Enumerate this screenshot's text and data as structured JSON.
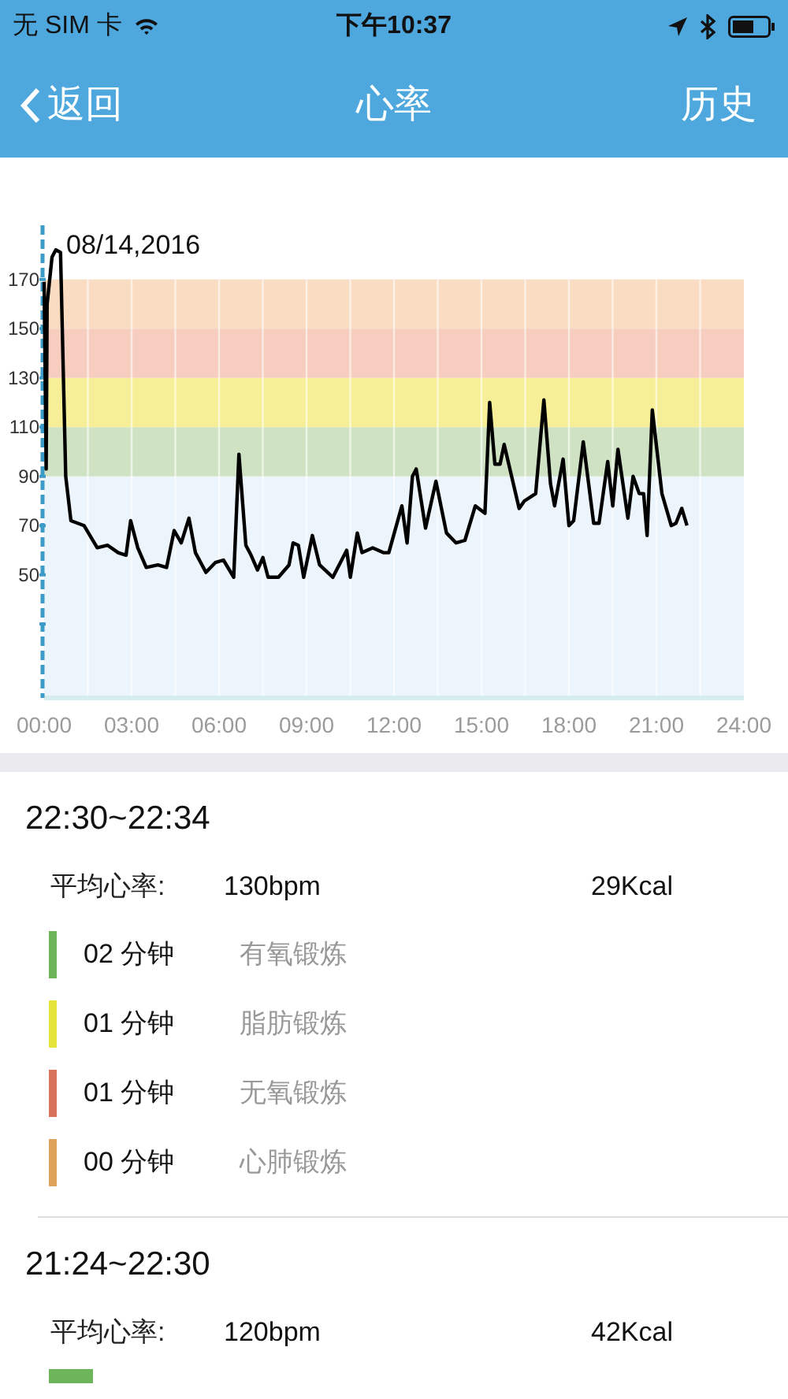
{
  "status_bar": {
    "carrier": "无 SIM 卡",
    "time": "下午10:37"
  },
  "nav": {
    "back": "返回",
    "title": "心率",
    "right": "历史"
  },
  "chart": {
    "date": "08/14,2016",
    "chart_data": {
      "type": "line",
      "xlim": [
        0,
        24
      ],
      "ylim": [
        0,
        192
      ],
      "grid": true,
      "bands": [
        {
          "axis": "y",
          "from": 0,
          "to": 90,
          "color": "#edf5fc"
        },
        {
          "axis": "y",
          "from": 90,
          "to": 110,
          "color": "#cfe3c4"
        },
        {
          "axis": "y",
          "from": 110,
          "to": 130,
          "color": "#f7ef97"
        },
        {
          "axis": "y",
          "from": 130,
          "to": 150,
          "color": "#f6cdbf"
        },
        {
          "axis": "y",
          "from": 150,
          "to": 170,
          "color": "#f9dcc2"
        }
      ],
      "xticks": [
        {
          "value": 0,
          "label": "00:00"
        },
        {
          "value": 3,
          "label": "03:00"
        },
        {
          "value": 6,
          "label": "06:00"
        },
        {
          "value": 9,
          "label": "09:00"
        },
        {
          "value": 12,
          "label": "12:00"
        },
        {
          "value": 15,
          "label": "15:00"
        },
        {
          "value": 18,
          "label": "18:00"
        },
        {
          "value": 21,
          "label": "21:00"
        },
        {
          "value": 24,
          "label": "24:00"
        }
      ],
      "yticks": [
        50,
        70,
        90,
        110,
        130,
        150,
        170
      ],
      "x": [
        0,
        0.07,
        0.1,
        0.27,
        0.4,
        0.56,
        0.74,
        0.92,
        1.37,
        1.82,
        2.18,
        2.54,
        2.81,
        2.97,
        3.21,
        3.5,
        3.9,
        4.2,
        4.46,
        4.7,
        4.97,
        5.19,
        5.55,
        5.87,
        6.15,
        6.5,
        6.68,
        6.92,
        7.1,
        7.32,
        7.5,
        7.68,
        8.04,
        8.4,
        8.54,
        8.72,
        8.9,
        9.2,
        9.45,
        9.9,
        10.38,
        10.5,
        10.74,
        10.9,
        11.27,
        11.64,
        11.82,
        12.27,
        12.45,
        12.63,
        12.76,
        13.08,
        13.44,
        13.8,
        14.13,
        14.43,
        14.79,
        15.12,
        15.28,
        15.46,
        15.64,
        15.78,
        16.29,
        16.47,
        16.86,
        17.14,
        17.37,
        17.51,
        17.8,
        18.0,
        18.16,
        18.49,
        18.85,
        19.03,
        19.33,
        19.5,
        19.68,
        20.02,
        20.2,
        20.41,
        20.56,
        20.68,
        20.86,
        21.19,
        21.51,
        21.67,
        21.87,
        22.05
      ],
      "series": [
        {
          "color": "#000000",
          "values": [
            169,
            93,
            160,
            179,
            182,
            181,
            90,
            72,
            70,
            61,
            62,
            59,
            58,
            72,
            61,
            53,
            54,
            53,
            68,
            63,
            73,
            59,
            51,
            55,
            56,
            49,
            99,
            62,
            58,
            52,
            57,
            49,
            49,
            54,
            63,
            62,
            49,
            66,
            54,
            49,
            60,
            49,
            67,
            59,
            61,
            59,
            59,
            78,
            63,
            90,
            93,
            69,
            88,
            67,
            63,
            64,
            78,
            75,
            120,
            95,
            95,
            103,
            77,
            80,
            83,
            121,
            87,
            78,
            97,
            70,
            72,
            104,
            71,
            71,
            96,
            78,
            101,
            73,
            90,
            83,
            83,
            66,
            117,
            83,
            70,
            71,
            77,
            70
          ]
        }
      ]
    }
  },
  "sessions": [
    {
      "time": "22:30~22:34",
      "avg_label": "平均心率:",
      "avg": "130bpm",
      "kcal": "29Kcal",
      "zones": [
        {
          "duration": "02 分钟",
          "name": "有氧锻炼",
          "color": "#6cb55a"
        },
        {
          "duration": "01 分钟",
          "name": "脂肪锻炼",
          "color": "#e4e43a"
        },
        {
          "duration": "01 分钟",
          "name": "无氧锻炼",
          "color": "#d7735a"
        },
        {
          "duration": "00 分钟",
          "name": "心肺锻炼",
          "color": "#dfa25a"
        }
      ]
    },
    {
      "time": "21:24~22:30",
      "avg_label": "平均心率:",
      "avg": "120bpm",
      "kcal": "42Kcal",
      "zones": [
        {
          "color": "#6cb55a"
        }
      ]
    }
  ]
}
